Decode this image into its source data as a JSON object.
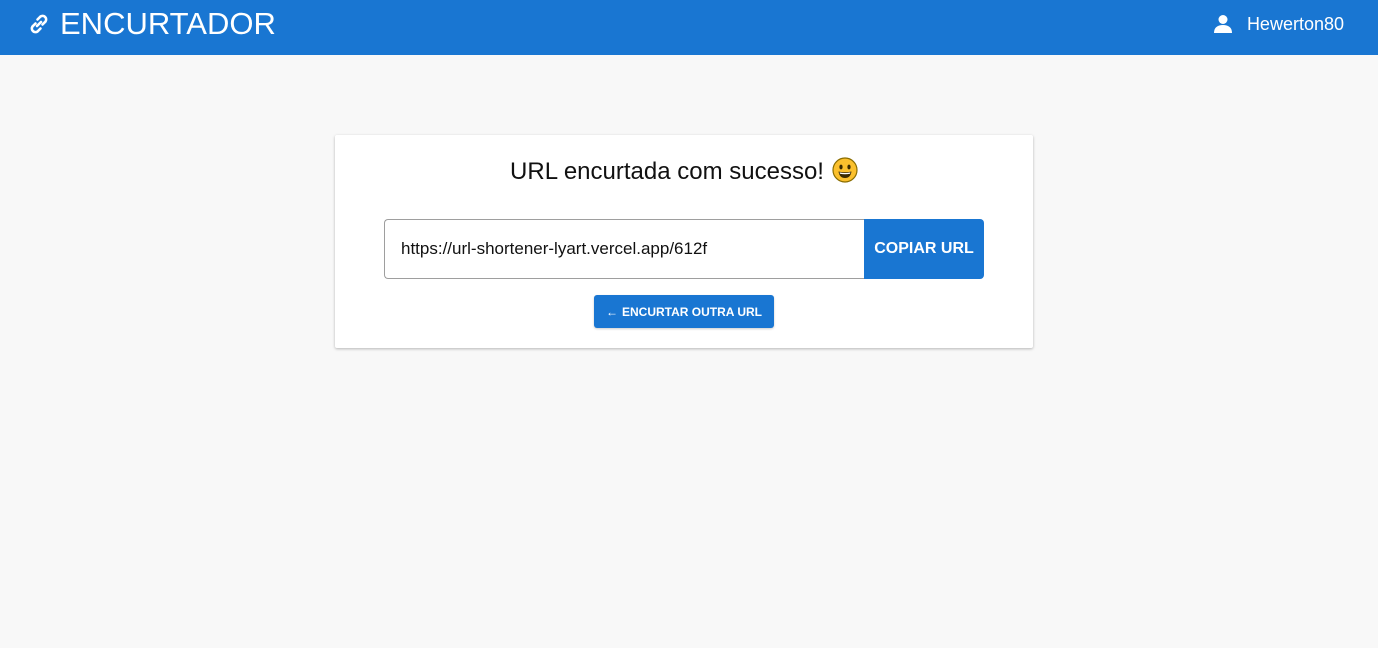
{
  "header": {
    "app_title": "ENCURTADOR",
    "brand_icon": "link-icon",
    "user_icon": "user-icon",
    "username": "Hewerton80",
    "accent_color": "#1976d2"
  },
  "card": {
    "title": "URL encurtada com sucesso!",
    "title_emoji": "grinning-face-emoji",
    "shortened_url": "https://url-shortener-lyart.vercel.app/612f",
    "copy_button_label": "COPIAR URL",
    "back_arrow": "←",
    "back_button_label": "ENCURTAR OUTRA URL"
  }
}
